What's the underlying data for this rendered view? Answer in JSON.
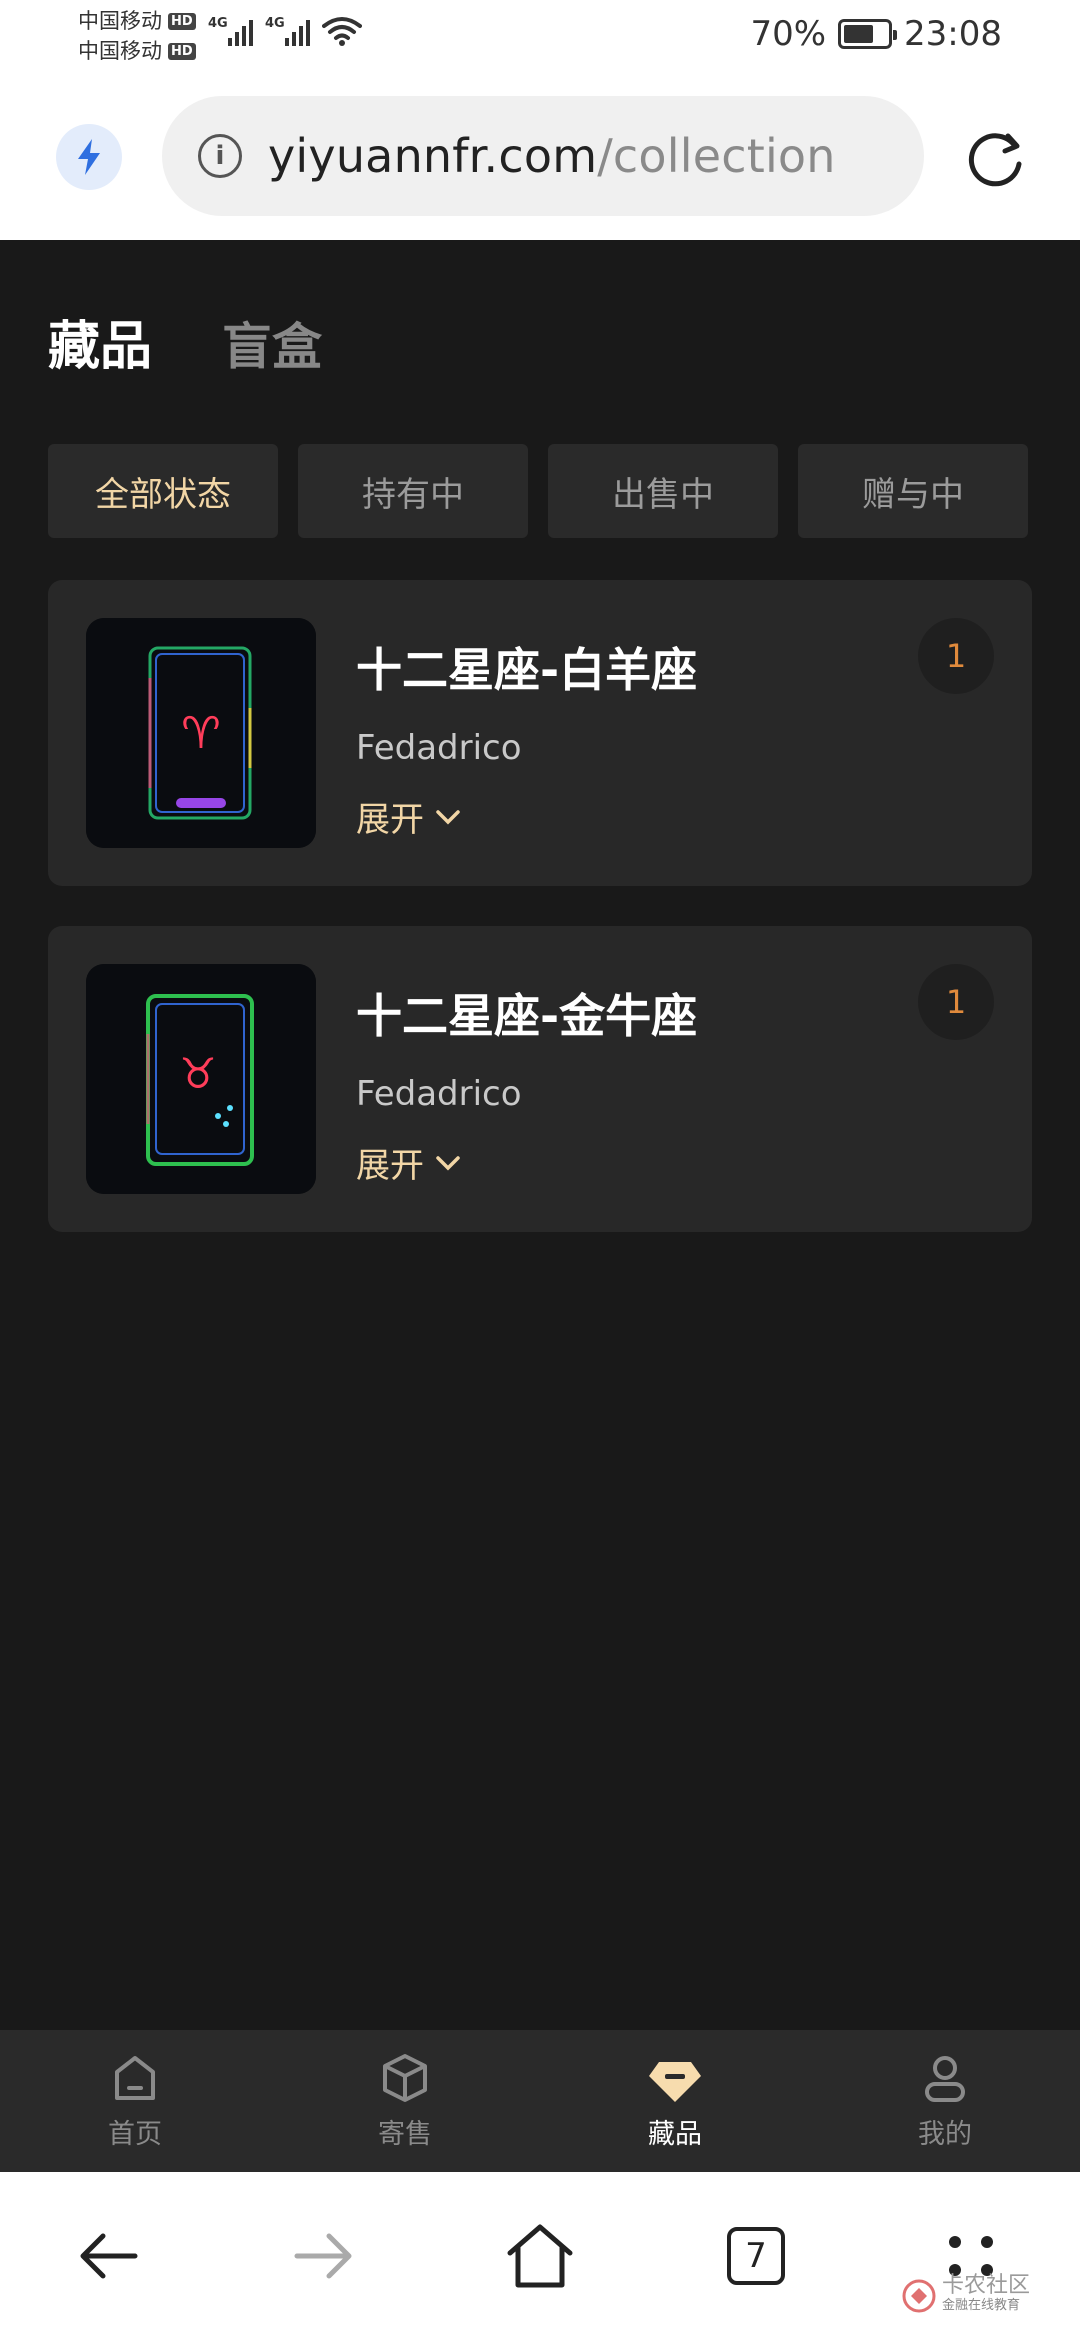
{
  "status_bar": {
    "carrier1": "中国移动",
    "carrier2": "中国移动",
    "hd": "HD",
    "net1": "4G",
    "net2": "4G",
    "battery_text": "70%",
    "battery_level": 0.7,
    "time": "23:08"
  },
  "browser": {
    "url_domain": "yiyuannfr.com",
    "url_path": "/collection",
    "tab_count": "7",
    "icons": [
      "bolt-icon",
      "info-icon",
      "reload-icon",
      "back-arrow-icon",
      "forward-arrow-icon",
      "home-icon",
      "more-icon"
    ]
  },
  "page": {
    "tabs": [
      {
        "label": "藏品",
        "active": true
      },
      {
        "label": "盲盒",
        "active": false
      }
    ],
    "filters": [
      {
        "label": "全部状态",
        "active": true
      },
      {
        "label": "持有中",
        "active": false
      },
      {
        "label": "出售中",
        "active": false
      },
      {
        "label": "赠与中",
        "active": false
      }
    ],
    "items": [
      {
        "title": "十二星座-白羊座",
        "author": "Fedadrico",
        "expand_label": "展开",
        "count": "1",
        "symbol": "♈",
        "accent": "#ff4060"
      },
      {
        "title": "十二星座-金牛座",
        "author": "Fedadrico",
        "expand_label": "展开",
        "count": "1",
        "symbol": "♉",
        "accent": "#ff4060"
      }
    ]
  },
  "bottom_nav": [
    {
      "label": "首页",
      "icon": "home-icon",
      "active": false
    },
    {
      "label": "寄售",
      "icon": "box-icon",
      "active": false
    },
    {
      "label": "藏品",
      "icon": "gem-icon",
      "active": true
    },
    {
      "label": "我的",
      "icon": "user-icon",
      "active": false
    }
  ],
  "watermark": {
    "main": "卡农社区",
    "sub": "金融在线教育"
  },
  "colors": {
    "page_bg": "#191919",
    "card_bg": "#282828",
    "accent_gold": "#f2d6a6",
    "count_orange": "#e08a3c"
  }
}
